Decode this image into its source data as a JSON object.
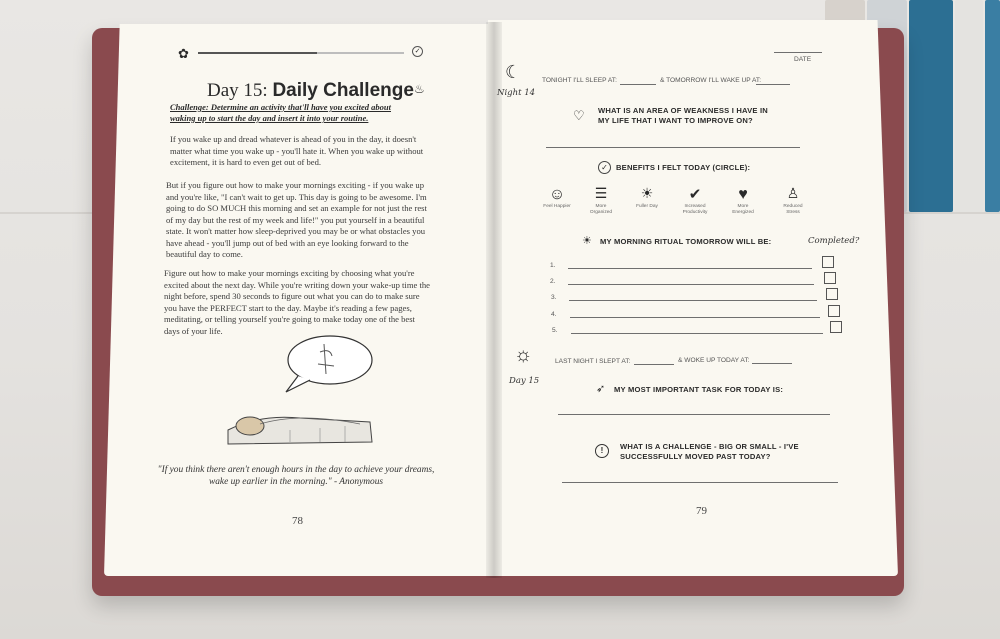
{
  "left_page": {
    "title_prefix": "Day 15:",
    "title_bold": "Daily Challenge",
    "challenge": "Challenge: Determine an activity that'll have you excited about waking up to start the day and insert it into your routine.",
    "paragraphs": [
      "If you wake up and dread whatever is ahead of you in the day, it doesn't matter what time you wake up - you'll hate it. When you wake up without excitement, it is hard to even get out of bed.",
      "But if you figure out how to make your mornings exciting - if you wake up and you're like, \"I can't wait to get up. This day is going to be awesome. I'm going to do SO MUCH this morning and set an example for not just the rest of my day but the rest of my week and life!\" you put yourself in a beautiful state. It won't matter how sleep-deprived you may be or what obstacles you have ahead - you'll jump out of bed with an eye looking forward to the beautiful day to come.",
      "Figure out how to make your mornings exciting by choosing what you're excited about the next day. While you're writing down your wake-up time the night before, spend 30 seconds to figure out what you can do to make sure you have the PERFECT start to the day. Maybe it's reading a few pages, meditating, or telling yourself you're going to make today one of the best days of your life."
    ],
    "quote": "\"If you think there aren't enough hours in the day to achieve your dreams, wake up earlier in the morning.\" - Anonymous",
    "page_number": "78"
  },
  "right_page": {
    "date_label": "DATE",
    "night_label": "Night 14",
    "sleep_label": "TONIGHT I'LL SLEEP AT:",
    "wake_label": "& TOMORROW I'LL WAKE UP AT:",
    "weakness_q": "WHAT IS AN AREA OF WEAKNESS I HAVE IN MY LIFE THAT I WANT TO IMPROVE ON?",
    "benefits_title": "BENEFITS I FELT TODAY (CIRCLE):",
    "benefits": [
      {
        "icon": "smiley-icon",
        "label": "Feel Happier"
      },
      {
        "icon": "checklist-icon",
        "label": "More Organized"
      },
      {
        "icon": "sunrise-icon",
        "label": "Fuller Day"
      },
      {
        "icon": "check-circle-icon",
        "label": "Increased Productivity"
      },
      {
        "icon": "heart-icon",
        "label": "More Energized"
      },
      {
        "icon": "meditation-icon",
        "label": "Reduced Stress"
      }
    ],
    "ritual_title": "MY MORNING RITUAL TOMORROW WILL BE:",
    "completed_label": "Completed?",
    "ritual_items": [
      "1.",
      "2.",
      "3.",
      "4.",
      "5."
    ],
    "day_label": "Day 15",
    "slept_label": "LAST NIGHT I SLEPT AT:",
    "woke_label": "& WOKE UP TODAY AT:",
    "task_title": "MY MOST IMPORTANT TASK FOR TODAY IS:",
    "challenge_q": "WHAT IS A CHALLENGE - BIG OR SMALL - I'VE SUCCESSFULLY MOVED PAST TODAY?",
    "page_number": "79"
  }
}
